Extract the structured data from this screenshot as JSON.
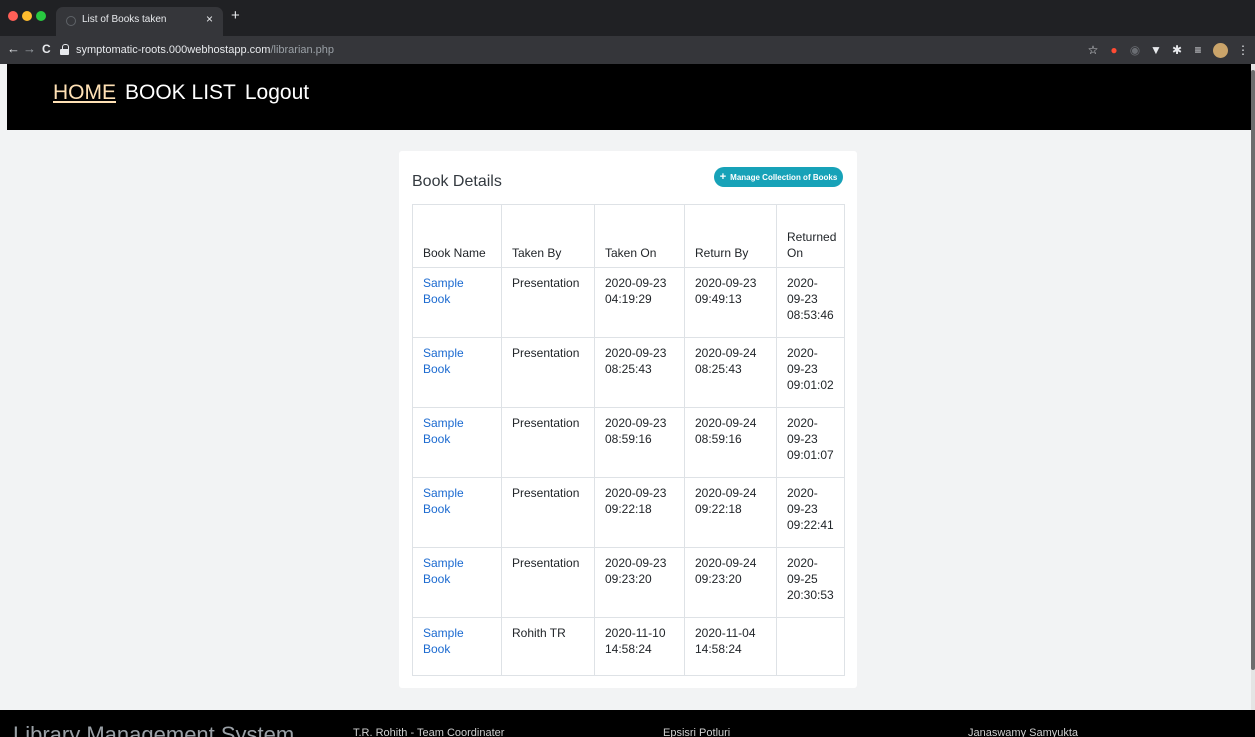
{
  "browser": {
    "tab_title": "List of Books taken",
    "tab_close": "×",
    "new_tab": "+",
    "url_host": "symptomatic-roots.000webhostapp.com",
    "url_path": "/librarian.php"
  },
  "nav": {
    "home": "HOME",
    "book_list": "BOOK LIST",
    "logout": "Logout"
  },
  "card": {
    "title": "Book Details",
    "manage_button": "Manage Collection of Books"
  },
  "table": {
    "headers": [
      "Book Name",
      "Taken By",
      "Taken On",
      "Return By",
      "Returned On"
    ],
    "rows": [
      {
        "book": "Sample Book",
        "taken_by": "Presentation",
        "taken_on": "2020-09-23 04:19:29",
        "return_by": "2020-09-23 09:49:13",
        "returned_on": "2020-09-23 08:53:46"
      },
      {
        "book": "Sample Book",
        "taken_by": "Presentation",
        "taken_on": "2020-09-23 08:25:43",
        "return_by": "2020-09-24 08:25:43",
        "returned_on": "2020-09-23 09:01:02"
      },
      {
        "book": "Sample Book",
        "taken_by": "Presentation",
        "taken_on": "2020-09-23 08:59:16",
        "return_by": "2020-09-24 08:59:16",
        "returned_on": "2020-09-23 09:01:07"
      },
      {
        "book": "Sample Book",
        "taken_by": "Presentation",
        "taken_on": "2020-09-23 09:22:18",
        "return_by": "2020-09-24 09:22:18",
        "returned_on": "2020-09-23 09:22:41"
      },
      {
        "book": "Sample Book",
        "taken_by": "Presentation",
        "taken_on": "2020-09-23 09:23:20",
        "return_by": "2020-09-24 09:23:20",
        "returned_on": "2020-09-25 20:30:53"
      },
      {
        "book": "Sample Book",
        "taken_by": "Rohith TR",
        "taken_on": "2020-11-10 14:58:24",
        "return_by": "2020-11-04 14:58:24",
        "returned_on": ""
      }
    ]
  },
  "footer": {
    "brand": "Library Management System",
    "members": [
      "T.R. Rohith - Team Coordinater",
      "Epsisri Potluri",
      "Janaswamy Samyukta"
    ]
  },
  "colors": {
    "header_bg": "#000000",
    "accent_button": "#17a2b8",
    "link": "#1b6ad0",
    "active_nav": "#ffe1b5"
  },
  "icons": [
    "lock-icon",
    "back-arrow-icon",
    "forward-arrow-icon",
    "reload-icon",
    "star-icon",
    "plus-icon"
  ]
}
